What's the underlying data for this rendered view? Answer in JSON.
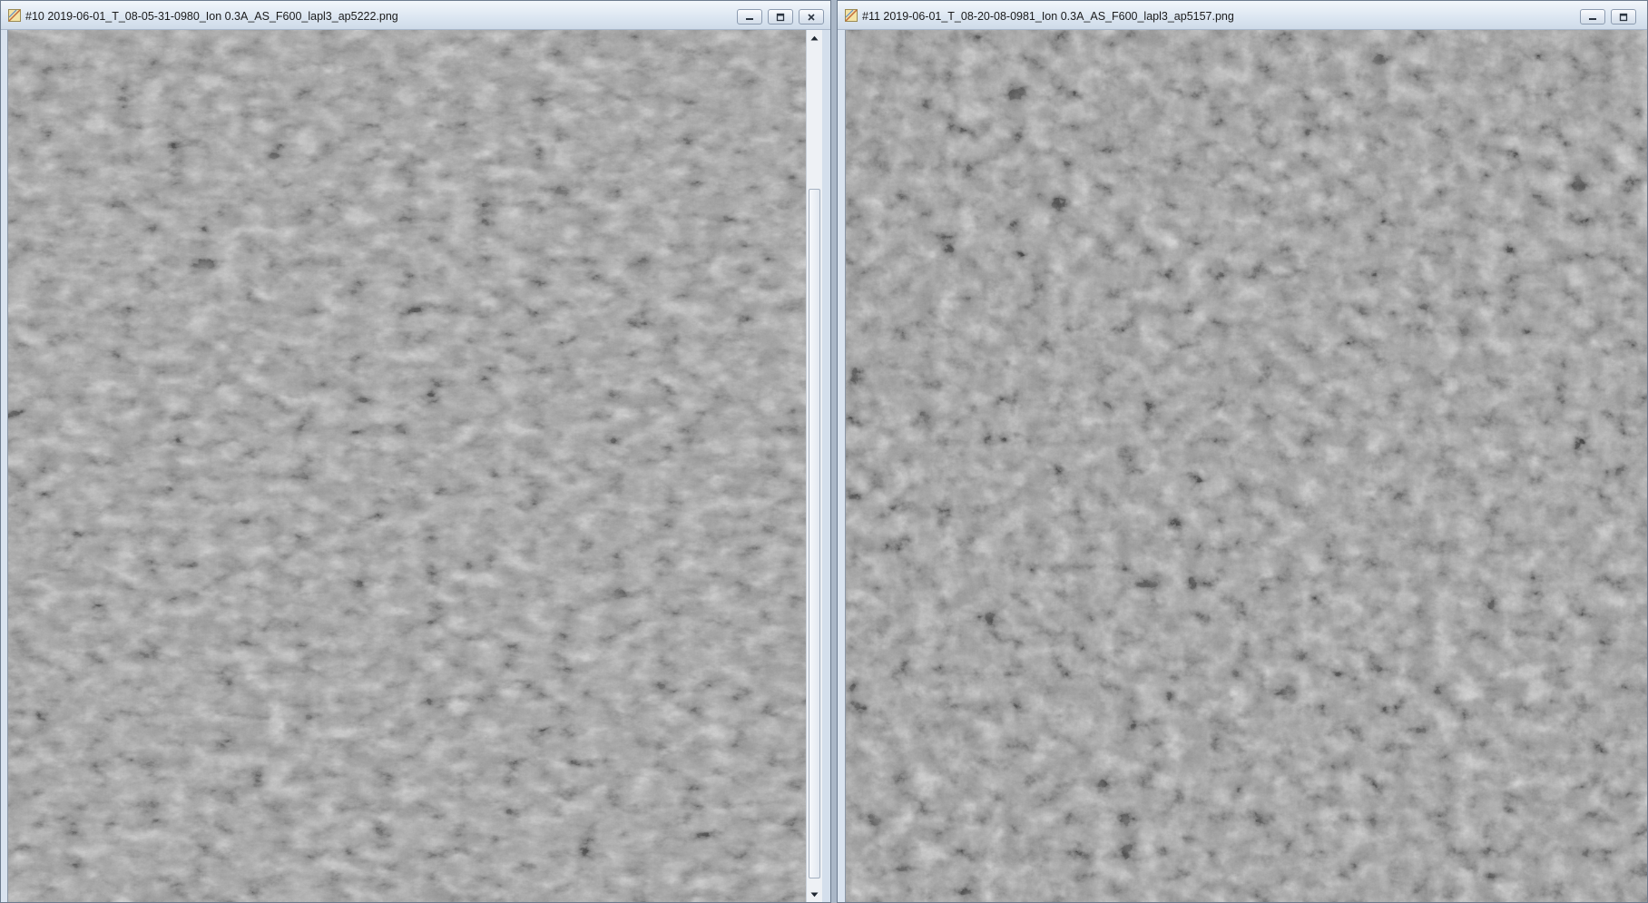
{
  "windows": [
    {
      "id": "left",
      "title": "#10 2019-06-01_T_08-05-31-0980_Ion 0.3A_AS_F600_lapl3_ap5222.png",
      "controls": [
        "minimize-icon",
        "maximize-icon",
        "close-icon"
      ],
      "has_vertical_scrollbar": true
    },
    {
      "id": "right",
      "title": "#11 2019-06-01_T_08-20-08-0981_Ion 0.3A_AS_F600_lapl3_ap5157.png",
      "controls": [
        "minimize-icon",
        "maximize-icon"
      ],
      "has_vertical_scrollbar": false
    }
  ],
  "icons": {
    "app": "image-document-icon",
    "minimize": "minimize-icon",
    "maximize": "maximize-icon",
    "close": "close-icon",
    "scroll_up": "scroll-up-arrow-icon",
    "scroll_down": "scroll-down-arrow-icon"
  },
  "colors": {
    "titlebar": "#dde7f2",
    "image_gray": "#9a9a9a",
    "frame": "#6d7c8f"
  }
}
